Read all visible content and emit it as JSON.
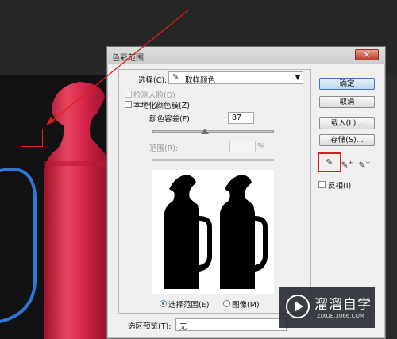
{
  "dialog": {
    "title": "色彩范围",
    "close_symbol": "×",
    "select_label": "选择(C):",
    "select_value": "取样颜色",
    "select_icon": "eyedropper-icon",
    "detect_faces_label": "检测人脸(D)",
    "localized_clusters_label": "本地化颜色簇(Z)",
    "fuzziness_label": "颜色容差(F):",
    "fuzziness_value": "87",
    "range_label": "范围(R):",
    "range_unit": "%",
    "selection_radio_label": "选择范围(E)",
    "image_radio_label": "图像(M)",
    "selection_preview_label": "选区预览(T):",
    "selection_preview_value": "无"
  },
  "buttons": {
    "ok": "确定",
    "cancel": "取消",
    "load": "载入(L)...",
    "save": "存储(S)..."
  },
  "invert_label": "反相(I)",
  "tools": [
    "eyedropper-icon",
    "eyedropper-plus-icon",
    "eyedropper-minus-icon"
  ],
  "watermark": {
    "name": "溜溜自学",
    "url": "ZIXUE.3066.COM"
  },
  "colors": {
    "accent_red": "#e11b1b",
    "bottle_red": "#d6264a",
    "workspace": "#121212"
  }
}
